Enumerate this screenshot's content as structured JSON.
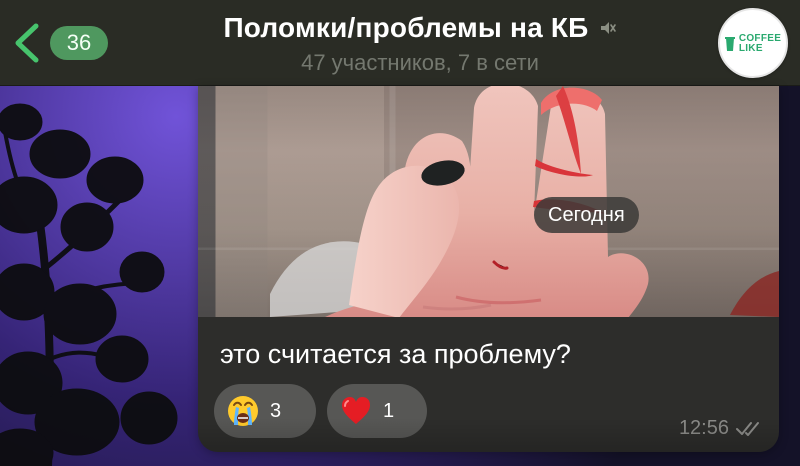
{
  "header": {
    "back_count": "36",
    "title": "Поломки/проблемы на КБ",
    "subtitle": "47 участников, 7 в сети",
    "logo_top": "COFFEE",
    "logo_bottom": "LIKE",
    "accent_color": "#47c46d",
    "header_color": "#2a2c25"
  },
  "message": {
    "date_label": "Сегодня",
    "text": "это считается за проблему?",
    "time": "12:56",
    "reactions": [
      {
        "icon": "crying-face-icon",
        "count": "3"
      },
      {
        "icon": "red-heart-icon",
        "count": "1"
      }
    ],
    "bubble_color": "#2d2d2b"
  },
  "wallpaper": {
    "primary_color": "#4d37a8"
  }
}
